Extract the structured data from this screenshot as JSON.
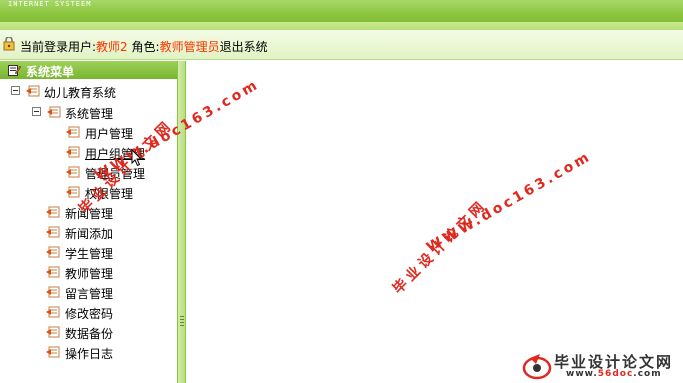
{
  "header": {
    "banner_text": "INTERNET SYSTEEM"
  },
  "userbar": {
    "current_user_label": "当前登录用户:",
    "current_user_value": "教师2",
    "role_label": "角色:",
    "role_value": "教师管理员",
    "logout_label": "退出系统"
  },
  "menu": {
    "title": "系统菜单",
    "root": "幼儿教育系统",
    "system_group": "系统管理",
    "sub_items": [
      "用户管理",
      "用户组管理",
      "管理员管理",
      "权限管理"
    ],
    "items": [
      "新闻管理",
      "新闻添加",
      "学生管理",
      "教师管理",
      "留言管理",
      "修改密码",
      "数据备份",
      "操作日志"
    ]
  },
  "watermarks": {
    "site": "WWW.doc163.com",
    "cn": "毕业设计论文网",
    "logo_cn": "毕业设计论文网",
    "logo_url_prefix": "www.",
    "logo_url_brand": "56doc",
    "logo_url_suffix": ".com"
  },
  "colors": {
    "banner_green": "#8cc63f",
    "highlight_red": "#ff3300",
    "watermark_red": "#e0281e"
  }
}
